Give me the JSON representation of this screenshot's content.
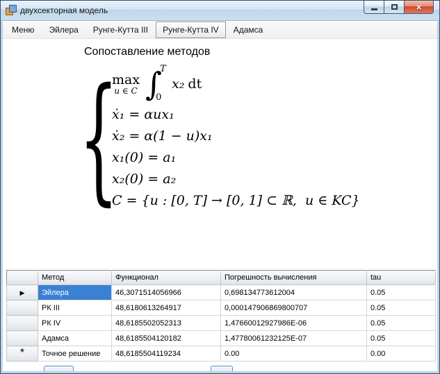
{
  "window": {
    "title": "двухсекторная модель",
    "controls": {
      "close_glyph": "×"
    }
  },
  "menu": {
    "items": [
      {
        "label": "Меню"
      },
      {
        "label": "Эйлера"
      },
      {
        "label": "Рунге-Кутта III"
      },
      {
        "label": "Рунге-Кутта IV",
        "selected": true
      },
      {
        "label": "Адамса"
      }
    ]
  },
  "content": {
    "heading": "Сопоставление методов",
    "formula": {
      "brace": "{",
      "max_label": "max",
      "max_sub": "u ∈ C",
      "int_top": "T",
      "int_sign": "∫",
      "int_bot": "0",
      "integrand_var": "x₂",
      "integrand_dt": "dt",
      "lines": [
        "ẋ₁ = αux₁",
        "ẋ₂ = α(1 − u)x₁",
        "x₁(0) = a₁",
        "x₂(0) = a₂",
        "C = {u : [0, T] → [0, 1] ⊂ ℝ,  u ∈ KC}"
      ]
    }
  },
  "table": {
    "columns": [
      "Метод",
      "Функционал",
      "Погрешность вычисления",
      "tau"
    ],
    "rows": [
      {
        "marker": "▶",
        "selected": true,
        "cells": [
          "Эйлера",
          "46,3071514056966",
          "0,698134773612004",
          "0.05"
        ]
      },
      {
        "marker": "",
        "cells": [
          "РК III",
          "48,6180613264917",
          "0,000147906869800707",
          "0.05"
        ]
      },
      {
        "marker": "",
        "cells": [
          "РК IV",
          "48,6185502052313",
          "1,47660012927986E-06",
          "0.05"
        ]
      },
      {
        "marker": "",
        "cells": [
          "Адамса",
          "48,6185504120182",
          "1,47780061232125E-07",
          "0.05"
        ]
      },
      {
        "marker": "*",
        "new_row": true,
        "cells": [
          "Точное решение",
          "48,6185504119234",
          "0.00",
          "0.00"
        ]
      }
    ]
  },
  "colors": {
    "selection_blue": "#3a80d4",
    "close_button_red": "#d0482f",
    "titlebar_blue": "#cce0f2",
    "frame_blue": "#bdd2e6"
  }
}
